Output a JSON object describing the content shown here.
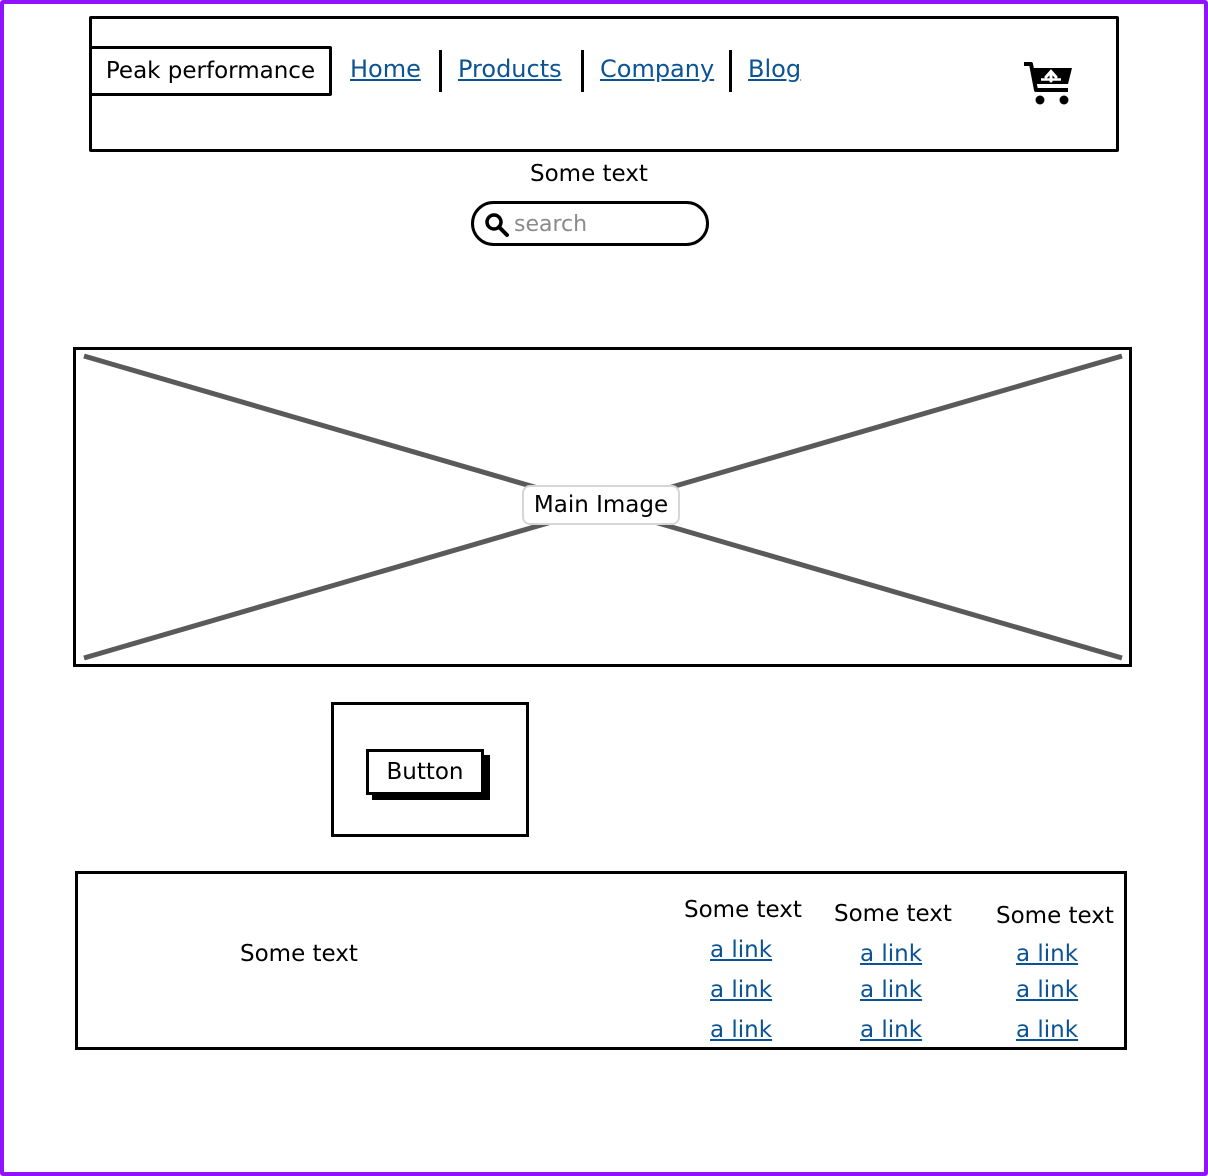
{
  "header": {
    "brand": "Peak performance",
    "nav": [
      "Home",
      "Products",
      "Company",
      "Blog"
    ],
    "cart_icon": "cart-upload-icon"
  },
  "hero": {
    "tagline": "Some text",
    "search_placeholder": "search"
  },
  "main_image": {
    "label": "Main Image"
  },
  "cta": {
    "button_label": "Button"
  },
  "footer": {
    "text": "Some text",
    "columns": [
      {
        "heading": "Some text",
        "links": [
          "a link",
          "a link",
          "a link"
        ]
      },
      {
        "heading": "Some text",
        "links": [
          "a link",
          "a link",
          "a link"
        ]
      },
      {
        "heading": "Some text",
        "links": [
          "a link",
          "a link",
          "a link"
        ]
      }
    ]
  },
  "colors": {
    "frame": "#9012fe",
    "link": "#0b5394",
    "placeholder_cross": "#5a5a5a"
  }
}
